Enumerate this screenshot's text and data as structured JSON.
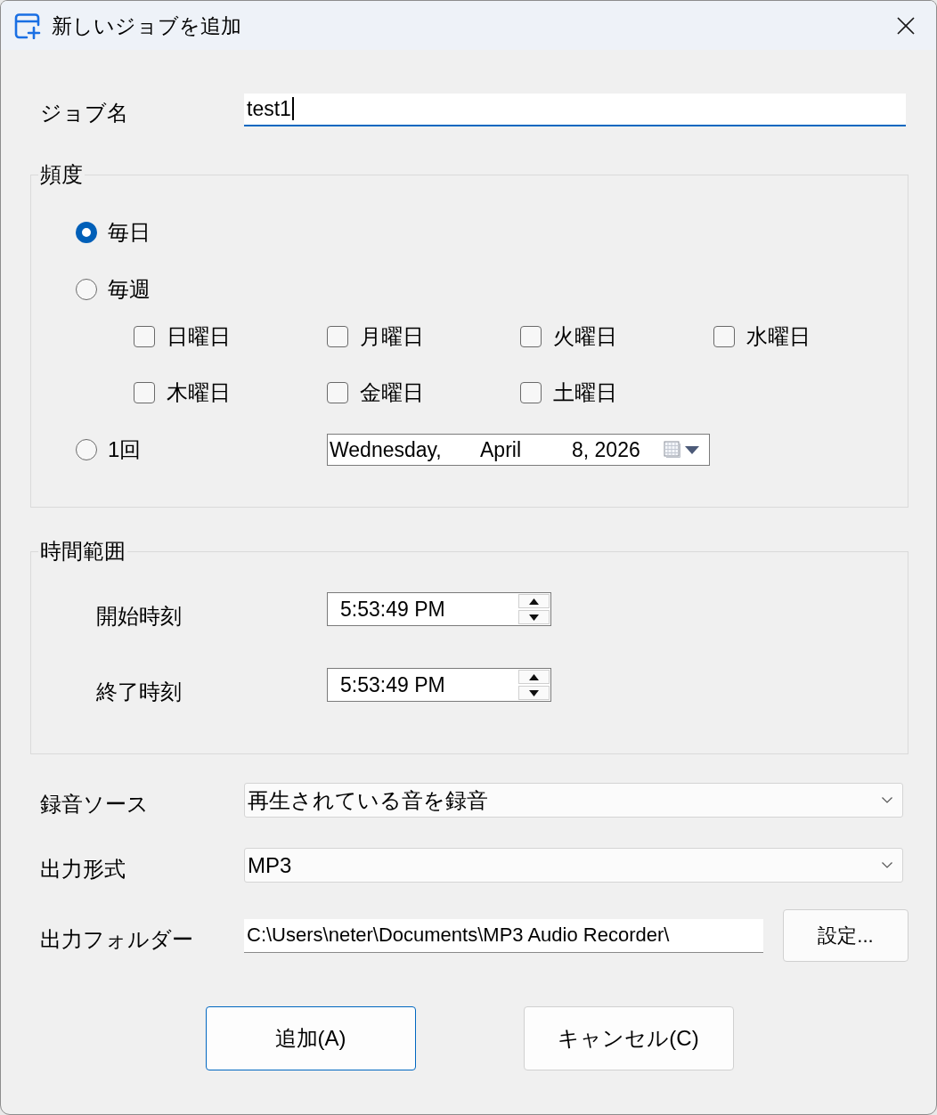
{
  "window": {
    "title": "新しいジョブを追加"
  },
  "job_name": {
    "label": "ジョブ名",
    "value": "test1",
    "focused": true
  },
  "frequency": {
    "title": "頻度",
    "options": [
      {
        "kind": "simple",
        "label": "毎日",
        "selected": true
      },
      {
        "kind": "weekly",
        "label": "毎週",
        "selected": false,
        "days": [
          {
            "label": "日曜日",
            "checked": false
          },
          {
            "label": "月曜日",
            "checked": false
          },
          {
            "label": "火曜日",
            "checked": false
          },
          {
            "label": "水曜日",
            "checked": false
          },
          {
            "label": "木曜日",
            "checked": false
          },
          {
            "label": "金曜日",
            "checked": false
          },
          {
            "label": "土曜日",
            "checked": false
          }
        ]
      },
      {
        "kind": "once",
        "label": "1回",
        "selected": false,
        "date": [
          "Wednesday,",
          "April",
          "8, 2026"
        ]
      }
    ]
  },
  "time_range": {
    "title": "時間範囲",
    "rows": [
      {
        "label": "開始時刻",
        "value": "5:53:49 PM"
      },
      {
        "label": "終了時刻",
        "value": "5:53:49 PM"
      }
    ]
  },
  "recording_source": {
    "label": "録音ソース",
    "value": "再生されている音を録音"
  },
  "output_format": {
    "label": "出力形式",
    "value": "MP3"
  },
  "output_folder": {
    "label": "出力フォルダー",
    "value": "C:\\Users\\neter\\Documents\\MP3 Audio Recorder\\",
    "button": "設定..."
  },
  "buttons": [
    {
      "label": "追加(A)",
      "default": true
    },
    {
      "label": "キャンセル(C)",
      "default": false
    }
  ]
}
